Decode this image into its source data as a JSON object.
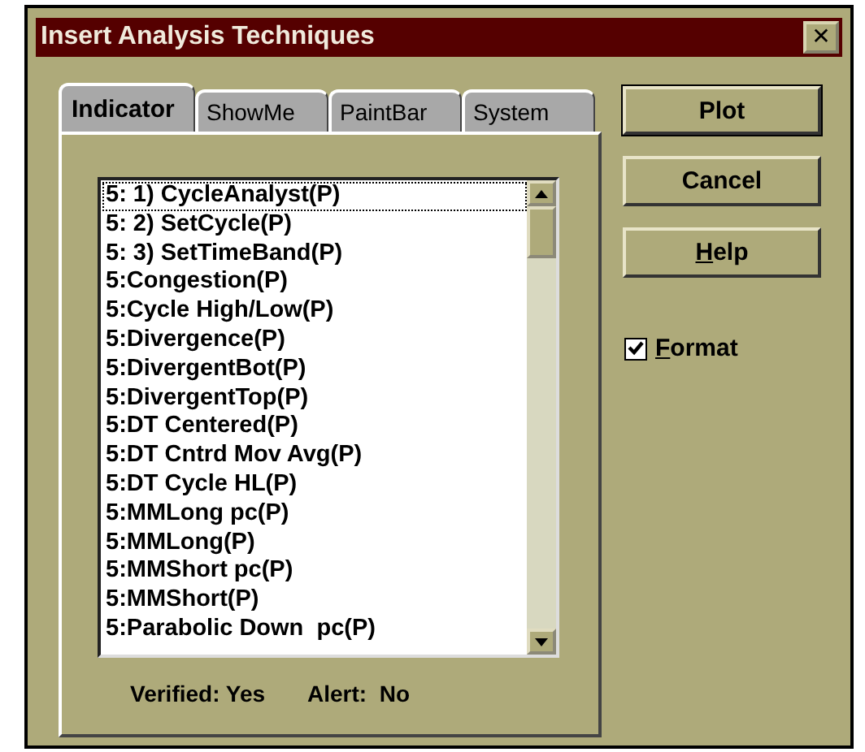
{
  "window": {
    "title": "Insert Analysis Techniques",
    "close": "✕"
  },
  "tabs": [
    {
      "label": "Indicator",
      "selected": true
    },
    {
      "label": "ShowMe",
      "selected": false
    },
    {
      "label": "PaintBar",
      "selected": false
    },
    {
      "label": "System",
      "selected": false
    }
  ],
  "list": {
    "items": [
      {
        "label": "5: 1) CycleAnalyst(P)",
        "selected": true
      },
      {
        "label": "5: 2) SetCycle(P)",
        "selected": false
      },
      {
        "label": "5: 3) SetTimeBand(P)",
        "selected": false
      },
      {
        "label": "5:Congestion(P)",
        "selected": false
      },
      {
        "label": "5:Cycle High/Low(P)",
        "selected": false
      },
      {
        "label": "5:Divergence(P)",
        "selected": false
      },
      {
        "label": "5:DivergentBot(P)",
        "selected": false
      },
      {
        "label": "5:DivergentTop(P)",
        "selected": false
      },
      {
        "label": "5:DT Centered(P)",
        "selected": false
      },
      {
        "label": "5:DT Cntrd Mov Avg(P)",
        "selected": false
      },
      {
        "label": "5:DT Cycle HL(P)",
        "selected": false
      },
      {
        "label": "5:MMLong pc(P)",
        "selected": false
      },
      {
        "label": "5:MMLong(P)",
        "selected": false
      },
      {
        "label": "5:MMShort pc(P)",
        "selected": false
      },
      {
        "label": "5:MMShort(P)",
        "selected": false
      },
      {
        "label": "5:Parabolic Down  pc(P)",
        "selected": false
      }
    ]
  },
  "status": [
    "Verified: Yes",
    "Alert:  No"
  ],
  "buttons": [
    {
      "label": "Plot",
      "default": true,
      "mnemonic": false
    },
    {
      "label": "Cancel",
      "default": false,
      "mnemonic": false
    },
    {
      "label": "Help",
      "default": false,
      "mnemonic": true
    }
  ],
  "format": {
    "label": "Format",
    "checked": true
  }
}
